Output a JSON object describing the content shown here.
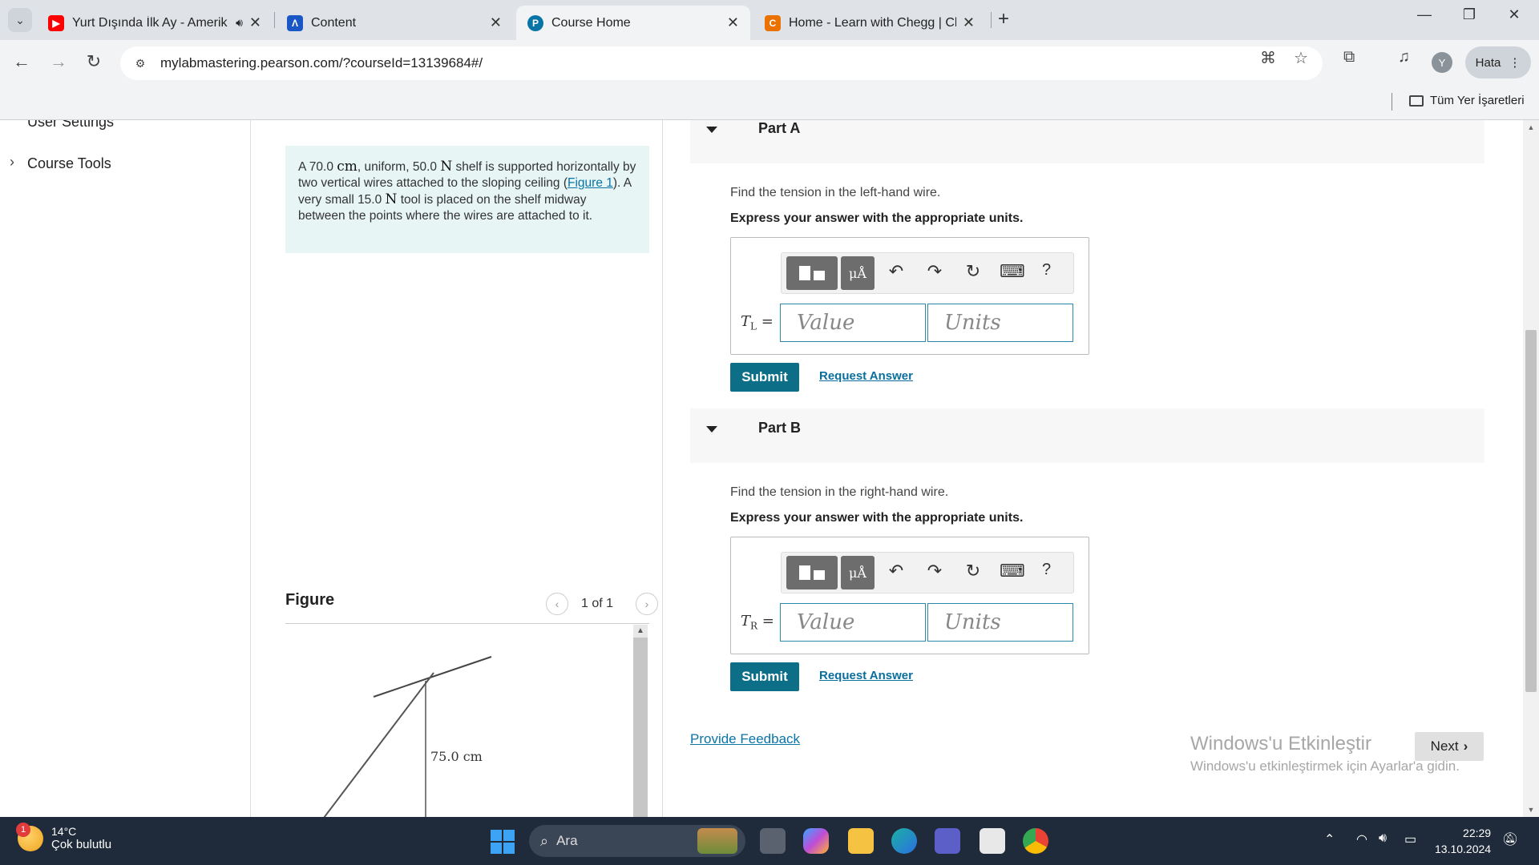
{
  "browser": {
    "tabs": [
      {
        "title": "Yurt Dışında İlk Ay - Amerik",
        "favicon": "youtube-icon",
        "color": "#ff0000",
        "sound": true
      },
      {
        "title": "Content",
        "favicon": "content-icon",
        "color": "#1a56c5"
      },
      {
        "title": "Course Home",
        "favicon": "pearson-icon",
        "color": "#0a74a7",
        "active": true
      },
      {
        "title": "Home - Learn with Chegg | Che",
        "favicon": "chegg-icon",
        "color": "#eb7100"
      }
    ],
    "url": "mylabmastering.pearson.com/?courseId=13139684#/",
    "profile_initial": "Y",
    "error_button": "Hata",
    "bookmarks_all": "Tüm Yer İşaretleri"
  },
  "sidebar": {
    "items": [
      {
        "label": "User Settings"
      },
      {
        "label": "Course Tools"
      }
    ]
  },
  "problem": {
    "text_1": "A 70.0 ",
    "unit_cm": "cm",
    "text_2": ", uniform, 50.0 ",
    "unit_N": "N",
    "text_3": " shelf is supported horizontally by two vertical wires attached to the sloping ceiling (",
    "figure_link": "Figure 1",
    "text_4": "). A very small 15.0 ",
    "text_5": " tool is placed on the shelf midway between the points where the wires are attached to it."
  },
  "figure": {
    "title": "Figure",
    "pager": "1 of 1",
    "label_height": "75.0 cm"
  },
  "parts": [
    {
      "title": "Part A",
      "question": "Find the tension in the left-hand wire.",
      "instruction": "Express your answer with the appropriate units.",
      "var_main": "T",
      "var_sub": "L",
      "value_placeholder": "Value",
      "units_placeholder": "Units",
      "submit": "Submit",
      "request": "Request Answer"
    },
    {
      "title": "Part B",
      "question": "Find the tension in the right-hand wire.",
      "instruction": "Express your answer with the appropriate units.",
      "var_main": "T",
      "var_sub": "R",
      "value_placeholder": "Value",
      "units_placeholder": "Units",
      "submit": "Submit",
      "request": "Request Answer"
    }
  ],
  "toolbar": {
    "units_glyph": "μÅ",
    "help": "?"
  },
  "footer": {
    "feedback": "Provide Feedback",
    "next": "Next",
    "activate_title": "Windows'u Etkinleştir",
    "activate_sub": "Windows'u etkinleştirmek için Ayarlar'a gidin."
  },
  "taskbar": {
    "temperature": "14°C",
    "weather": "Çok bulutlu",
    "weather_badge": "1",
    "search": "Ara",
    "time": "22:29",
    "date": "13.10.2024"
  },
  "colors": {
    "accent": "#0d6e87",
    "link": "#0a74a7",
    "problem_bg": "#e7f5f5"
  }
}
